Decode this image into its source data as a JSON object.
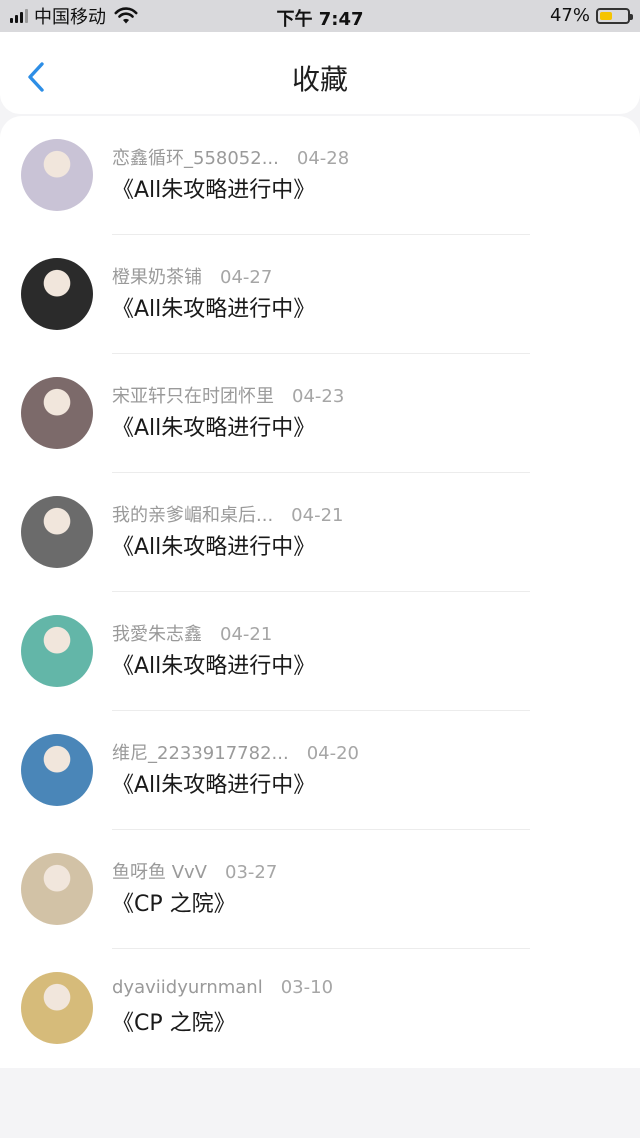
{
  "status_bar": {
    "carrier": "中国移动",
    "time": "下午 7:47",
    "battery": "47%",
    "battery_level": 0.47
  },
  "header": {
    "title": "收藏",
    "back_icon": "chevron-left-icon",
    "accent": "#2d8ee6"
  },
  "favorites": [
    {
      "user": "恋鑫循环_558052...",
      "date": "04-28",
      "title": "《All朱攻略进行中》",
      "avatar": "#c9c3d6"
    },
    {
      "user": "橙果奶茶铺",
      "date": "04-27",
      "title": "《All朱攻略进行中》",
      "avatar": "#2b2b2b"
    },
    {
      "user": "宋亚轩只在时团怀里",
      "date": "04-23",
      "title": "《All朱攻略进行中》",
      "avatar": "#7c6a6a"
    },
    {
      "user": "我的亲爹嵋和桌后...",
      "date": "04-21",
      "title": "《All朱攻略进行中》",
      "avatar": "#6b6b6b"
    },
    {
      "user": "我愛朱志鑫",
      "date": "04-21",
      "title": "《All朱攻略进行中》",
      "avatar": "#63b6a8"
    },
    {
      "user": "维尼_2233917782...",
      "date": "04-20",
      "title": "《All朱攻略进行中》",
      "avatar": "#4a86b8"
    },
    {
      "user": "鱼呀鱼 VvV",
      "date": "03-27",
      "title": "《CP 之院》",
      "avatar": "#d2c2a6"
    },
    {
      "user": "dyaviidyurnmanl",
      "date": "03-10",
      "title": "《CP 之院》",
      "avatar": "#d6bb7a"
    }
  ]
}
